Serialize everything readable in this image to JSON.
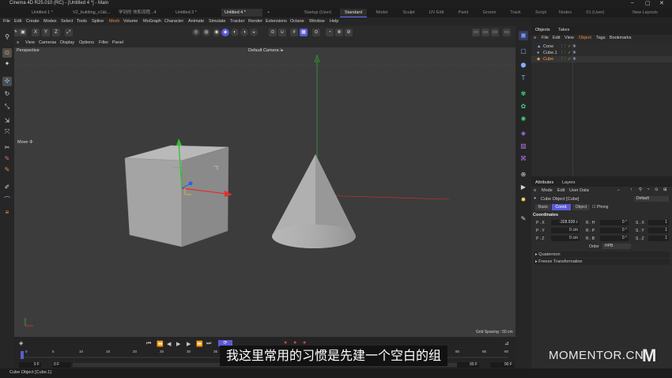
{
  "window": {
    "title": "Cinema 4D R25.010 (RC) - [Untitled 4 *] - Main",
    "controls": [
      "–",
      "▢",
      "✕"
    ]
  },
  "doc_tabs": [
    "Untitled 1 *",
    "V2_building_v1&t...",
    "学到的 块和流程...4",
    "Untitled 3 *",
    "Untitled 4 *"
  ],
  "active_doc_tab": "Untitled 4 *",
  "new_tab_label": "+",
  "layout_tabs": [
    "Startup (User)",
    "Standard",
    "Model",
    "Sculpt",
    "UV Edit",
    "Paint",
    "Groom",
    "Track",
    "Script",
    "Nodes",
    "01 (User)"
  ],
  "active_layout": "Standard",
  "new_layouts": "New Layouts",
  "menu": [
    "File",
    "Edit",
    "Create",
    "Modes",
    "Select",
    "Tools",
    "Spline",
    "Mesh",
    "Volume",
    "MoGraph",
    "Character",
    "Animate",
    "Simulate",
    "Tracker",
    "Render",
    "Extensions",
    "Octane",
    "Window",
    "Help"
  ],
  "menu_highlight": "Mesh",
  "toolbar_axes": [
    "X",
    "Y",
    "Z"
  ],
  "viewport": {
    "menu": [
      "View",
      "Cameras",
      "Display",
      "Options",
      "Filter",
      "Panel"
    ],
    "name": "Perspective",
    "camera": "Default Camera ⁝▸",
    "tool_label": "Move ✣",
    "grid_spacing": "Grid Spacing : 50 cm"
  },
  "objects_panel": {
    "tabs": [
      "Objects",
      "Takes"
    ],
    "menu": [
      "File",
      "Edit",
      "View",
      "Object",
      "Tags",
      "Bookmarks"
    ],
    "menu_highlight": "Object",
    "items": [
      {
        "name": "Cone",
        "color": "#cfcfcf"
      },
      {
        "name": "Cube.1",
        "color": "#cfcfcf"
      },
      {
        "name": "Cube",
        "color": "#f0a23a"
      }
    ]
  },
  "attributes_panel": {
    "tabs": [
      "Attributes",
      "Layers"
    ],
    "menu": [
      "Mode",
      "Edit",
      "User Data"
    ],
    "object_title": "Cube Object [Cube]",
    "preset": "Default",
    "subtabs": [
      "Basic",
      "Coord.",
      "Object",
      "Phong"
    ],
    "active_subtab": "Coord.",
    "section": "Coordinates",
    "rows": [
      {
        "p_label": "P . X",
        "p_value": "-328.938 c",
        "r_label": "R . H",
        "r_value": "0 °",
        "s_label": "S . X",
        "s_value": "1"
      },
      {
        "p_label": "P . Y",
        "p_value": "0 cm",
        "r_label": "R . P",
        "r_value": "0 °",
        "s_label": "S . Y",
        "s_value": "1"
      },
      {
        "p_label": "P . Z",
        "p_value": "0 cm",
        "r_label": "R . B",
        "r_value": "0 °",
        "s_label": "S . Z",
        "s_value": "1"
      }
    ],
    "order_label": "Order",
    "order_value": "HPB",
    "groups": [
      "▸ Quaternion",
      "▸ Freeze Transformation"
    ]
  },
  "timeline": {
    "ticks": [
      "0",
      "5",
      "10",
      "15",
      "20",
      "25",
      "30",
      "35",
      "40",
      "45",
      "50",
      "55",
      "60",
      "65",
      "70",
      "75",
      "80",
      "85",
      "90"
    ],
    "start_frame": "0 F",
    "current_frame": "0 F",
    "end_frame": "90 F",
    "end_frame2": "90 F"
  },
  "status": "Cube Object [Cube.1]",
  "subtitle": "我这里常用的习惯是先建一个空白的组",
  "watermark": "MOMENTOR.CN",
  "watermark_logo": "M",
  "colors": {
    "accent": "#5b5bd6",
    "highlight": "#f08a3a",
    "axis_x": "#e03030",
    "axis_y": "#30c030",
    "axis_z": "#3060e0"
  }
}
